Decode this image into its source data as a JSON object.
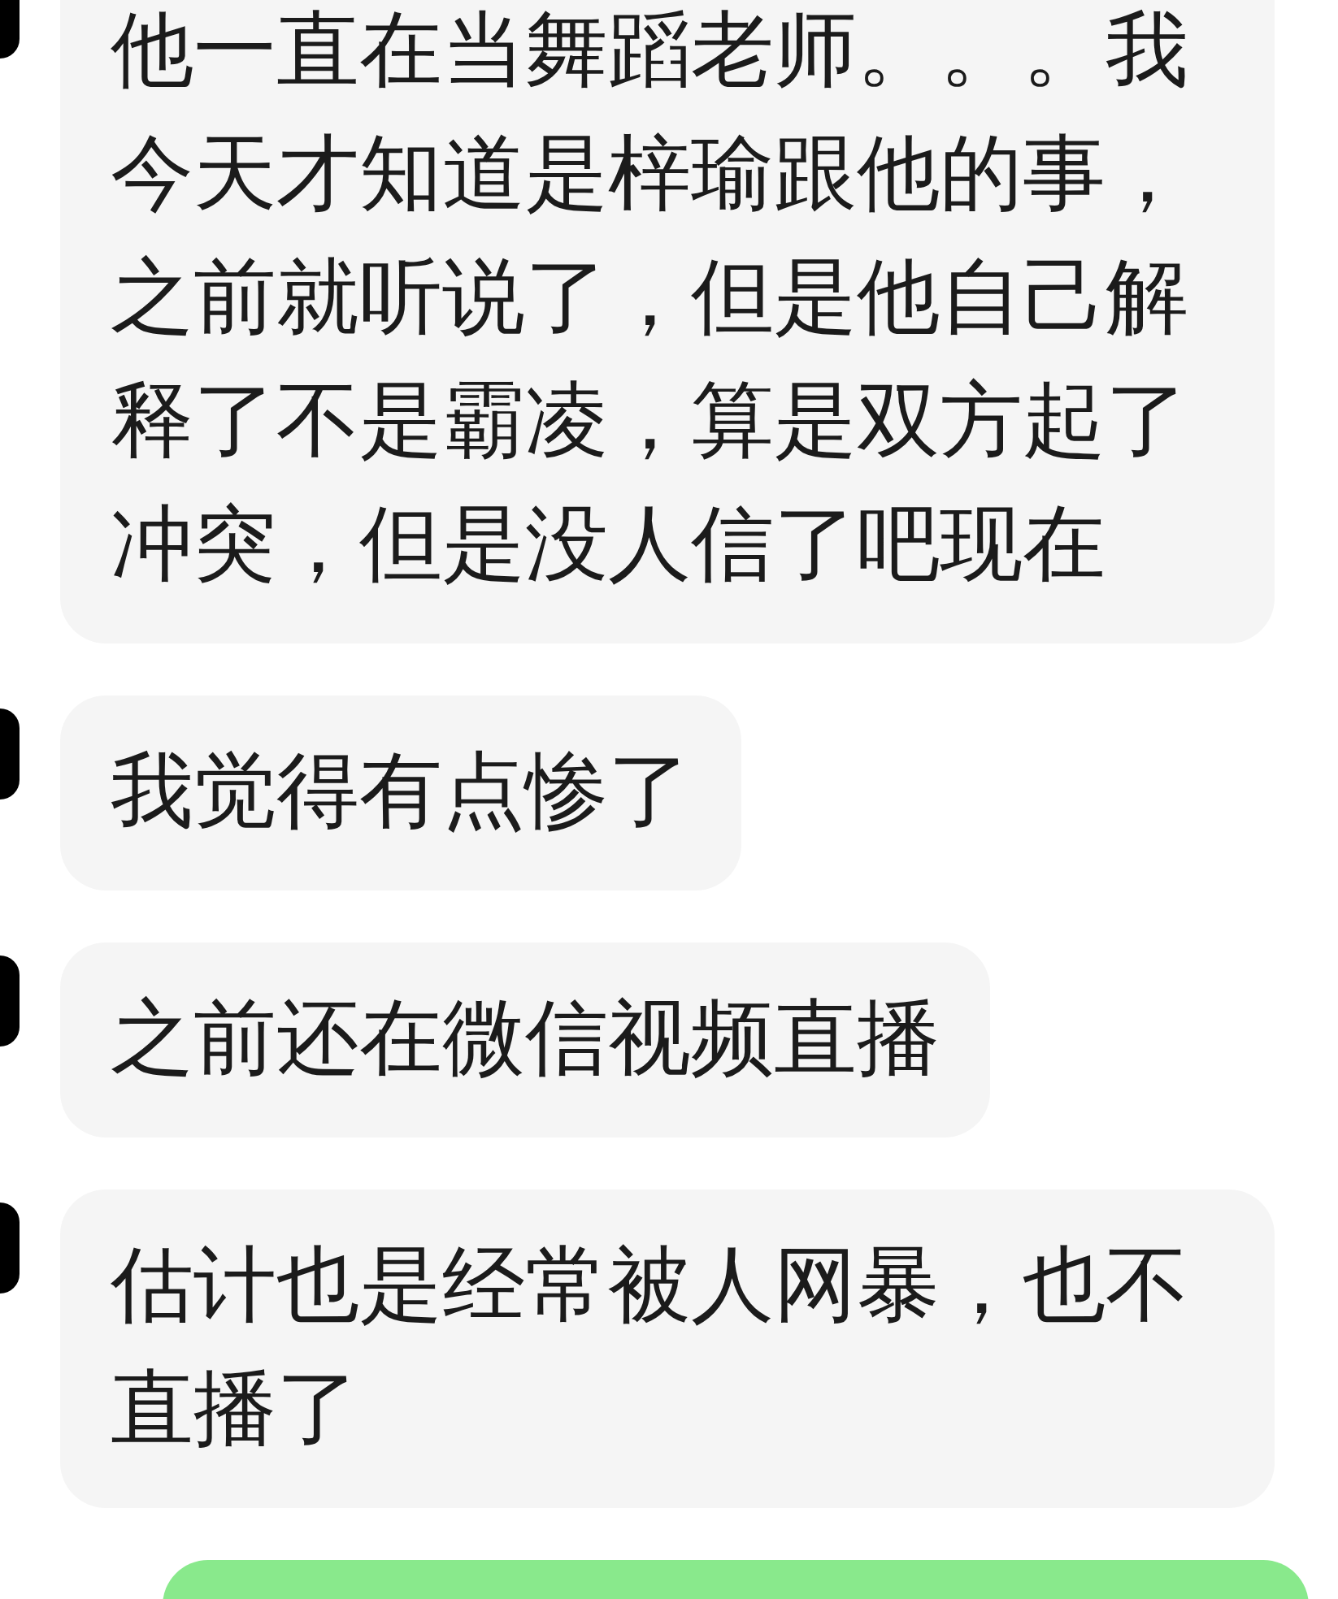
{
  "messages": [
    {
      "kind": "received",
      "text": "他一直在当舞蹈老师。。。我今天才知道是梓瑜跟他的事，之前就听说了，但是他自己解释了不是霸凌，算是双方起了冲突，但是没人信了吧现在"
    },
    {
      "kind": "received",
      "text": "我觉得有点惨了"
    },
    {
      "kind": "received",
      "text": "之前还在微信视频直播"
    },
    {
      "kind": "received",
      "text": "估计也是经常被人网暴，也不直播了"
    },
    {
      "kind": "sent"
    }
  ]
}
